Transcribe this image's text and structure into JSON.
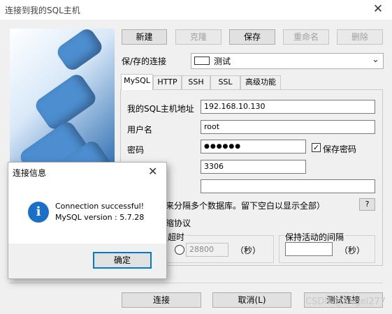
{
  "window": {
    "title": "连接到我的SQL主机",
    "close_label": "✕"
  },
  "toolbar": {
    "new": "新建",
    "clone": "克隆",
    "save": "保存",
    "rename": "重命名",
    "delete": "删除"
  },
  "saved_connection": {
    "label": "保/存的连接",
    "value": "测试"
  },
  "tabs": [
    {
      "label": "MySQL",
      "active": true
    },
    {
      "label": "HTTP"
    },
    {
      "label": "SSH"
    },
    {
      "label": "SSL"
    },
    {
      "label": "高级功能"
    }
  ],
  "form": {
    "host_label": "我的SQL主机地址",
    "host_value": "192.168.10.130",
    "user_label": "用户名",
    "user_value": "root",
    "password_label": "密码",
    "password_value": "●●●●●●",
    "save_password_label": "保存密码",
    "save_password_checked": "✓",
    "port_value": "3306",
    "database_value": "",
    "database_hint": "来分隔多个数据库。留下空白以显示全部）",
    "help_label": "?",
    "compress_label": "缩协议",
    "timeout_label": "超时",
    "timeout_value": "28800",
    "timeout_unit": "（秒）",
    "keepalive_label": "保持活动的间隔",
    "keepalive_value": "",
    "keepalive_unit": "（秒）"
  },
  "footer": {
    "connect": "连接",
    "cancel": "取消(L)",
    "test": "测试连接"
  },
  "watermark": "CSDN @angel277",
  "dialog": {
    "title": "连接信息",
    "close_label": "✕",
    "icon_glyph": "i",
    "message_line1": "Connection successful!",
    "message_line2": "MySQL version : 5.7.28",
    "ok": "确定"
  }
}
